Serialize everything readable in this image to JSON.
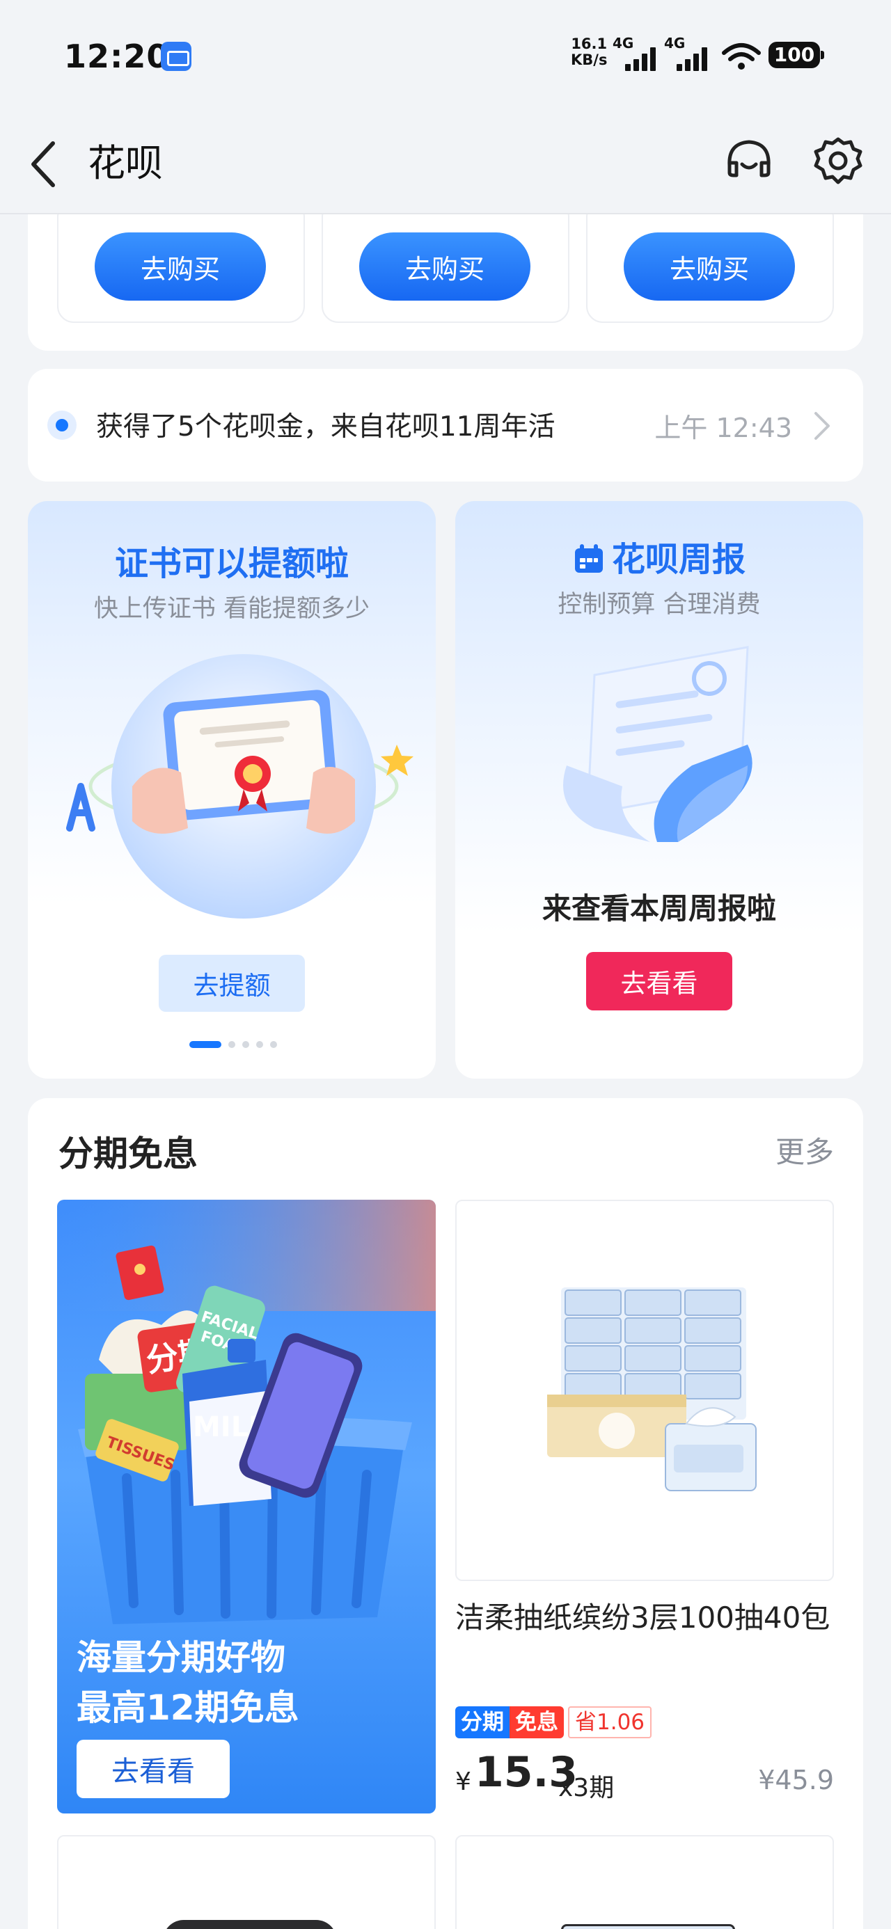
{
  "status_bar": {
    "time": "12:20",
    "speed_value": "16.1",
    "speed_unit": "KB/s",
    "network_1": "4G",
    "network_2": "4G",
    "battery": "100"
  },
  "header": {
    "title": "花呗",
    "back_icon": "chevron-left-icon",
    "service_icon": "headset-icon",
    "settings_icon": "gear-icon"
  },
  "buy_row": {
    "buttons": [
      "去购买",
      "去购买",
      "去购买"
    ]
  },
  "notice": {
    "text": "获得了5个花呗金，来自花呗11周年活",
    "time": "上午 12:43"
  },
  "promo_left": {
    "title": "证书可以提额啦",
    "subtitle": "快上传证书 看能提额多少",
    "button": "去提额",
    "carousel_active_index": 0,
    "carousel_count": 5
  },
  "promo_right": {
    "title": "花呗周报",
    "subtitle": "控制预算 合理消费",
    "note": "来查看本周周报啦",
    "button": "去看看",
    "title_icon": "calendar-icon"
  },
  "installment": {
    "title": "分期免息",
    "more": "更多",
    "banner": {
      "line1": "海量分期好物",
      "line2": "最高12期免息",
      "button": "去看看",
      "stickers": {
        "fenqi": "分期",
        "milk": "MILK",
        "foam_line1": "FACIAL",
        "foam_line2": "FOAM",
        "tissues": "TISSUES"
      }
    },
    "product": {
      "name": "洁柔抽纸缤纷3层100抽40包",
      "tag_installment": "分期",
      "tag_free": "免息",
      "tag_save": "省1.06",
      "currency": "¥",
      "price": "15.3",
      "period": "x3期",
      "original_price": "¥45.9"
    }
  },
  "colors": {
    "accent_blue": "#1677ff",
    "accent_red": "#f0285a",
    "page_bg": "#f2f4f7"
  }
}
